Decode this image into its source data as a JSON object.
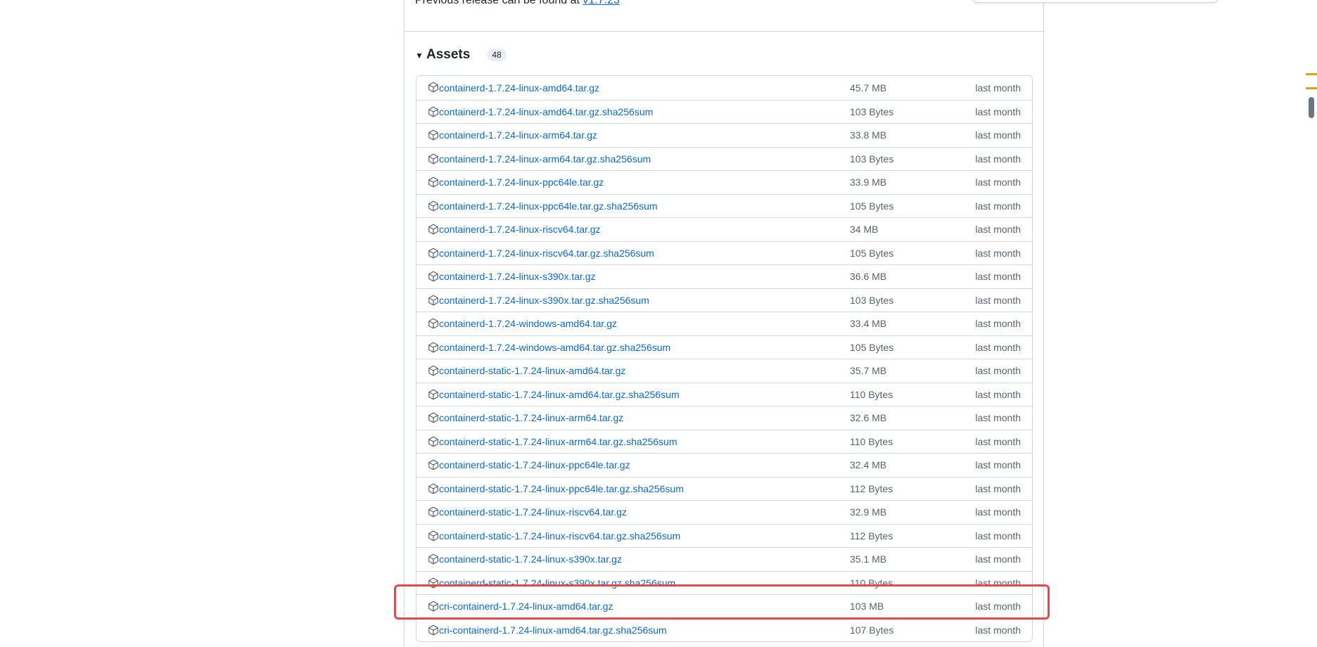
{
  "previous_release": {
    "text": "Previous release can be found at ",
    "link": "v1.7.23"
  },
  "assets": {
    "title": "Assets",
    "count": "48",
    "rows": [
      {
        "name": "containerd-1.7.24-linux-amd64.tar.gz",
        "size": "45.7 MB",
        "time": "last month"
      },
      {
        "name": "containerd-1.7.24-linux-amd64.tar.gz.sha256sum",
        "size": "103 Bytes",
        "time": "last month"
      },
      {
        "name": "containerd-1.7.24-linux-arm64.tar.gz",
        "size": "33.8 MB",
        "time": "last month"
      },
      {
        "name": "containerd-1.7.24-linux-arm64.tar.gz.sha256sum",
        "size": "103 Bytes",
        "time": "last month"
      },
      {
        "name": "containerd-1.7.24-linux-ppc64le.tar.gz",
        "size": "33.9 MB",
        "time": "last month"
      },
      {
        "name": "containerd-1.7.24-linux-ppc64le.tar.gz.sha256sum",
        "size": "105 Bytes",
        "time": "last month"
      },
      {
        "name": "containerd-1.7.24-linux-riscv64.tar.gz",
        "size": "34 MB",
        "time": "last month"
      },
      {
        "name": "containerd-1.7.24-linux-riscv64.tar.gz.sha256sum",
        "size": "105 Bytes",
        "time": "last month"
      },
      {
        "name": "containerd-1.7.24-linux-s390x.tar.gz",
        "size": "36.6 MB",
        "time": "last month"
      },
      {
        "name": "containerd-1.7.24-linux-s390x.tar.gz.sha256sum",
        "size": "103 Bytes",
        "time": "last month"
      },
      {
        "name": "containerd-1.7.24-windows-amd64.tar.gz",
        "size": "33.4 MB",
        "time": "last month"
      },
      {
        "name": "containerd-1.7.24-windows-amd64.tar.gz.sha256sum",
        "size": "105 Bytes",
        "time": "last month"
      },
      {
        "name": "containerd-static-1.7.24-linux-amd64.tar.gz",
        "size": "35.7 MB",
        "time": "last month"
      },
      {
        "name": "containerd-static-1.7.24-linux-amd64.tar.gz.sha256sum",
        "size": "110 Bytes",
        "time": "last month"
      },
      {
        "name": "containerd-static-1.7.24-linux-arm64.tar.gz",
        "size": "32.6 MB",
        "time": "last month"
      },
      {
        "name": "containerd-static-1.7.24-linux-arm64.tar.gz.sha256sum",
        "size": "110 Bytes",
        "time": "last month"
      },
      {
        "name": "containerd-static-1.7.24-linux-ppc64le.tar.gz",
        "size": "32.4 MB",
        "time": "last month"
      },
      {
        "name": "containerd-static-1.7.24-linux-ppc64le.tar.gz.sha256sum",
        "size": "112 Bytes",
        "time": "last month"
      },
      {
        "name": "containerd-static-1.7.24-linux-riscv64.tar.gz",
        "size": "32.9 MB",
        "time": "last month"
      },
      {
        "name": "containerd-static-1.7.24-linux-riscv64.tar.gz.sha256sum",
        "size": "112 Bytes",
        "time": "last month"
      },
      {
        "name": "containerd-static-1.7.24-linux-s390x.tar.gz",
        "size": "35.1 MB",
        "time": "last month"
      },
      {
        "name": "containerd-static-1.7.24-linux-s390x.tar.gz.sha256sum",
        "size": "110 Bytes",
        "time": "last month"
      },
      {
        "name": "cri-containerd-1.7.24-linux-amd64.tar.gz",
        "size": "103 MB",
        "time": "last month"
      },
      {
        "name": "cri-containerd-1.7.24-linux-amd64.tar.gz.sha256sum",
        "size": "107 Bytes",
        "time": "last month"
      }
    ]
  },
  "icons": {
    "caret": "triangle-down-icon",
    "asset": "package-icon"
  },
  "colors": {
    "link": "#0969da",
    "muted": "#59636e",
    "border": "#d0d7de",
    "highlight": "#e5484d"
  }
}
